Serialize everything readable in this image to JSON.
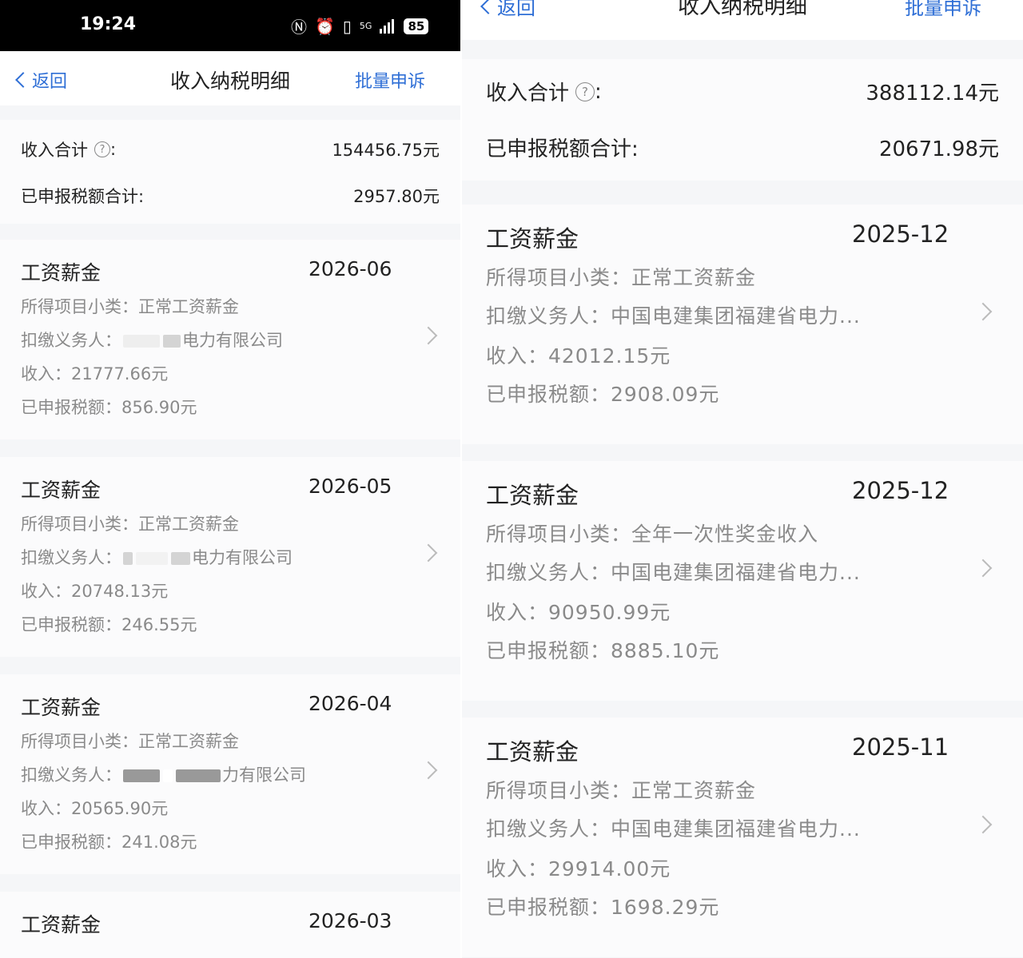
{
  "left": {
    "status_bar": {
      "time": "19:24",
      "network": "5G",
      "battery": "85"
    },
    "nav": {
      "back_label": "返回",
      "title": "收入纳税明细",
      "action_label": "批量申诉"
    },
    "summary": {
      "income_label": "收入合计",
      "income_value": "154456.75元",
      "tax_label": "已申报税额合计:",
      "tax_value": "2957.80元"
    },
    "records": [
      {
        "title": "工资薪金",
        "date": "2026-06",
        "subtype": "所得项目小类：正常工资薪金",
        "payer_prefix": "扣缴义务人：",
        "payer_suffix": "电力有限公司",
        "income": "收入：21777.66元",
        "tax": "已申报税额：856.90元"
      },
      {
        "title": "工资薪金",
        "date": "2026-05",
        "subtype": "所得项目小类：正常工资薪金",
        "payer_prefix": "扣缴义务人：",
        "payer_suffix": "电力有限公司",
        "income": "收入：20748.13元",
        "tax": "已申报税额：246.55元"
      },
      {
        "title": "工资薪金",
        "date": "2026-04",
        "subtype": "所得项目小类：正常工资薪金",
        "payer_prefix": "扣缴义务人：",
        "payer_suffix": "力有限公司",
        "income": "收入：20565.90元",
        "tax": "已申报税额：241.08元"
      },
      {
        "title": "工资薪金",
        "date": "2026-03"
      }
    ]
  },
  "right": {
    "nav": {
      "back_label": "返回",
      "title": "收入纳税明细",
      "action_label": "批量申诉"
    },
    "summary": {
      "income_label": "收入合计",
      "income_value": "388112.14元",
      "tax_label": "已申报税额合计:",
      "tax_value": "20671.98元"
    },
    "records": [
      {
        "title": "工资薪金",
        "date": "2025-12",
        "subtype": "所得项目小类：正常工资薪金",
        "payer": "扣缴义务人：中国电建集团福建省电力...",
        "income": "收入：42012.15元",
        "tax": "已申报税额：2908.09元"
      },
      {
        "title": "工资薪金",
        "date": "2025-12",
        "subtype": "所得项目小类：全年一次性奖金收入",
        "payer": "扣缴义务人：中国电建集团福建省电力...",
        "income": "收入：90950.99元",
        "tax": "已申报税额：8885.10元"
      },
      {
        "title": "工资薪金",
        "date": "2025-11",
        "subtype": "所得项目小类：正常工资薪金",
        "payer": "扣缴义务人：中国电建集团福建省电力...",
        "income": "收入：29914.00元",
        "tax": "已申报税额：1698.29元"
      }
    ]
  }
}
